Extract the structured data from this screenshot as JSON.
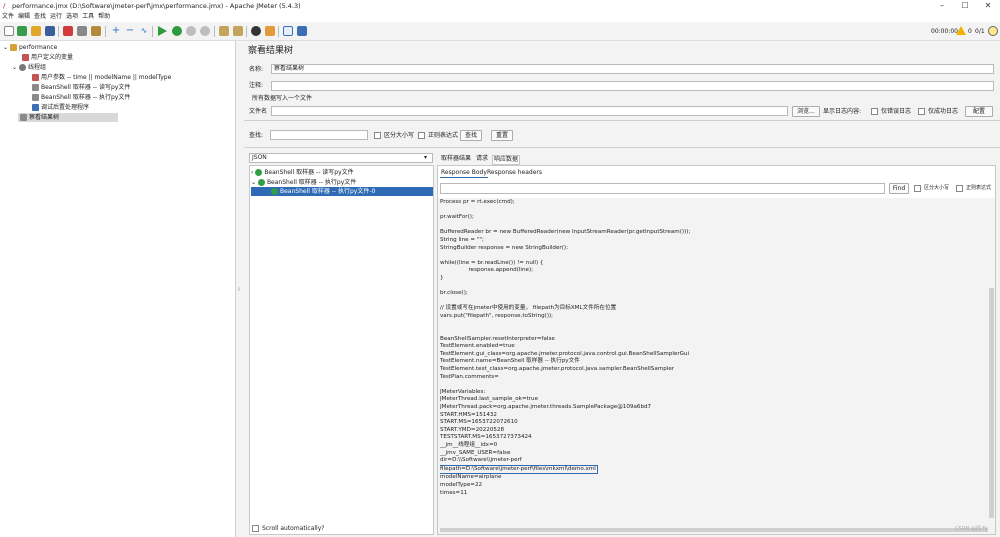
{
  "window": {
    "title": "performance.jmx (D:\\Software\\jmeter-perf\\jmx\\performance.jmx) - Apache JMeter (5.4.3)",
    "minimize": "–",
    "maximize": "☐",
    "close": "✕"
  },
  "menu": [
    "文件",
    "编辑",
    "查找",
    "运行",
    "选项",
    "工具",
    "帮助"
  ],
  "status": {
    "time": "00:00:00",
    "warnings": "0",
    "threads": "0/1"
  },
  "tree": {
    "root": "performance",
    "items": [
      {
        "label": "用户定义的变量"
      },
      {
        "label": "线程组"
      },
      {
        "label": "用户参数 -- time || modelName || modelType"
      },
      {
        "label": "BeanShell 取样器 -- 读写py文件"
      },
      {
        "label": "BeanShell 取样器 -- 执行py文件"
      },
      {
        "label": "调试后置处理程序"
      },
      {
        "label": "察看结果树"
      }
    ]
  },
  "panel": {
    "heading": "察看结果树",
    "name_label": "名称:",
    "name_value": "察看结果树",
    "comment_label": "注释:",
    "section_label": "所有数据写入一个文件",
    "file_label": "文件名",
    "browse": "浏览...",
    "display_log": "显示日志内容:",
    "errors_only": "仅错误日志",
    "success_only": "仅成功日志",
    "configure": "配置"
  },
  "search": {
    "label": "查找:",
    "case": "区分大小写",
    "regex": "正则表达式",
    "find": "查找",
    "reset": "重置"
  },
  "results": {
    "renderer": "JSON",
    "items": [
      "BeanShell 取样器 -- 读写py文件",
      "BeanShell 取样器 -- 执行py文件",
      "BeanShell 取样器 -- 执行py文件-0"
    ],
    "scroll_auto": "Scroll automatically?"
  },
  "tabs": {
    "main": [
      "取样器结果",
      "请求",
      "响应数据"
    ],
    "sub": [
      "Response Body",
      "Response headers"
    ]
  },
  "find": {
    "button": "Find",
    "case": "区分大小写",
    "regex": "正则表达式"
  },
  "code_lines": [
    "Process pr = rt.exec(cmd);",
    "",
    "pr.waitFor();",
    "",
    "BufferedReader br = new BufferedReader(new InputStreamReader(pr.getInputStream()));",
    "String line = \"\";",
    "StringBuilder response = new StringBuilder();",
    "",
    "while((line = br.readLine()) != null) {",
    "                response.append(line);",
    "}",
    "",
    "br.close();",
    "",
    "// 设置或写在jmeter中使用的变量， filepath为目标XML文件所在位置",
    "vars.put(\"filepath\", response.toString());",
    "",
    "",
    "BeanShellSampler.resetInterpreter=false",
    "TestElement.enabled=true",
    "TestElement.gui_class=org.apache.jmeter.protocol.java.control.gui.BeanShellSamplerGui",
    "TestElement.name=BeanShell 取样器 -- 执行py文件",
    "TestElement.test_class=org.apache.jmeter.protocol.java.sampler.BeanShellSampler",
    "TestPlan.comments=",
    "",
    "JMeterVariables:",
    "JMeterThread.last_sample_ok=true",
    "JMeterThread.pack=org.apache.jmeter.threads.SamplePackage@109a6bd7",
    "START.HMS=151432",
    "START.MS=1653722072610",
    "START.YMD=20220528",
    "TESTSTART.MS=1653727373424",
    "__jm__线程组__idx=0",
    "__jmv_SAME_USER=false",
    "dir=D:\\\\Software\\\\jmeter-perf"
  ],
  "highlight_line": "filepath=D:\\Software\\jmeter-perf\\files\\mkxml\\demo.xml",
  "code_tail": [
    "modelName=airplane",
    "modelType=22",
    "times=11"
  ],
  "watermark": "CSDN @周 Fy"
}
